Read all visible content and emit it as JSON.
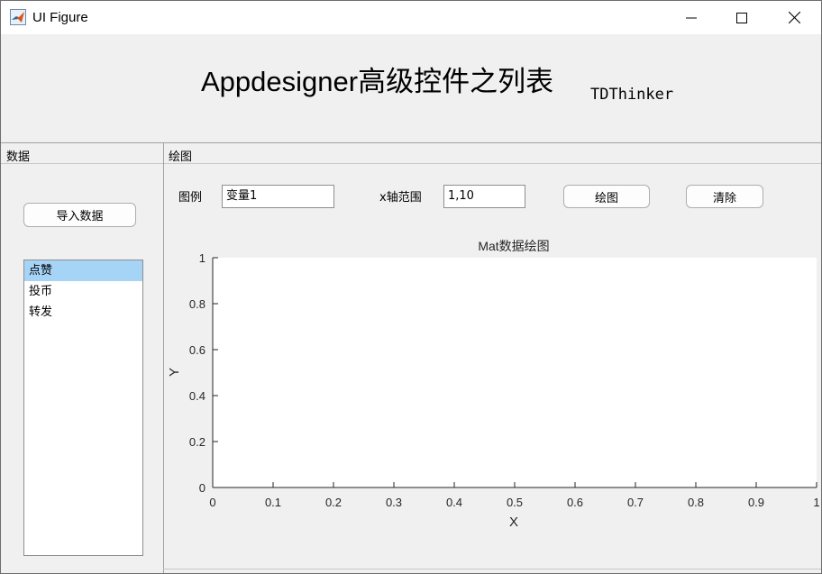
{
  "window": {
    "title": "UI Figure"
  },
  "header": {
    "title": "Appdesigner高级控件之列表",
    "subtitle": "TDThinker"
  },
  "left_panel": {
    "title": "数据",
    "import_button": "导入数据",
    "list_items": [
      {
        "label": "点赞",
        "selected": true
      },
      {
        "label": "投币",
        "selected": false
      },
      {
        "label": "转发",
        "selected": false
      }
    ]
  },
  "right_panel": {
    "title": "绘图",
    "legend_label": "图例",
    "legend_value": "变量1",
    "xrange_label": "x轴范围",
    "xrange_value": "1,10",
    "plot_button": "绘图",
    "clear_button": "清除"
  },
  "chart_data": {
    "type": "line",
    "title": "Mat数据绘图",
    "xlabel": "X",
    "ylabel": "Y",
    "xlim": [
      0,
      1
    ],
    "ylim": [
      0,
      1
    ],
    "xticks": [
      "0",
      "0.1",
      "0.2",
      "0.3",
      "0.4",
      "0.5",
      "0.6",
      "0.7",
      "0.8",
      "0.9",
      "1"
    ],
    "yticks": [
      "0",
      "0.2",
      "0.4",
      "0.6",
      "0.8",
      "1"
    ],
    "series": [],
    "grid": false
  },
  "colors": {
    "selection": "#a6d4f7",
    "axis": "#262626",
    "background": "#f0f0f0"
  }
}
